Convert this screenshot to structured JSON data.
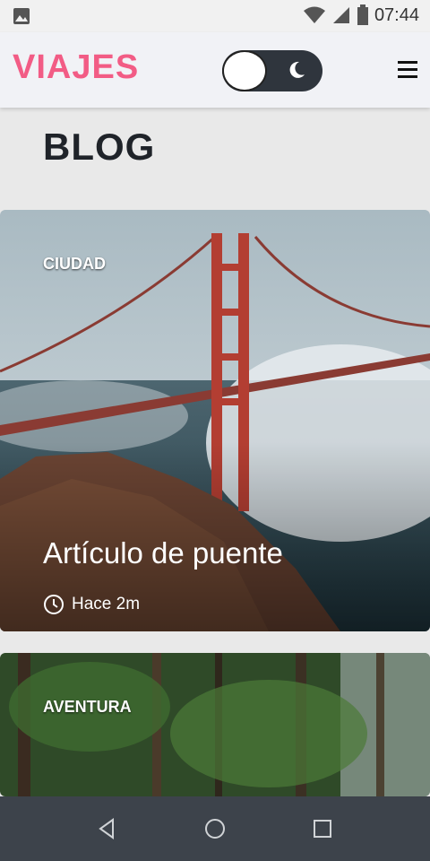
{
  "status_bar": {
    "time": "07:44"
  },
  "app_bar": {
    "logo": "VIAJES"
  },
  "page": {
    "title": "BLOG"
  },
  "cards": [
    {
      "category": "CIUDAD",
      "title": "Artículo de puente",
      "time": "Hace 2m"
    },
    {
      "category": "AVENTURA"
    }
  ],
  "colors": {
    "accent": "#f25c85",
    "dark": "#2f353d"
  }
}
